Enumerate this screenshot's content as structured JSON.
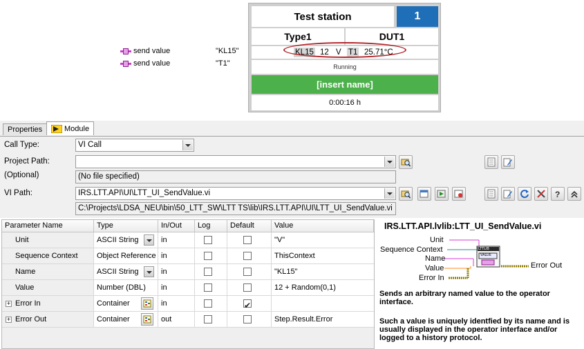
{
  "sequence_steps": [
    {
      "label": "send value",
      "value": "\"KL15\""
    },
    {
      "label": "send value",
      "value": "\"T1\""
    }
  ],
  "station": {
    "title": "Test station",
    "number": "1",
    "type": "Type1",
    "dut": "DUT1",
    "kl15_label": "KL15",
    "kl15_value": "12",
    "kl15_unit": "V",
    "t1_label": "T1",
    "t1_value": "25.71°C",
    "status": "Running",
    "name_placeholder": "[insert name]",
    "elapsed": "0:00:16 h",
    "colors": {
      "number_bg": "#1f6fb8",
      "name_bg": "#4cb04b",
      "highlight_oval": "#b2262a"
    }
  },
  "tabs": [
    {
      "label": "Properties",
      "active": false
    },
    {
      "label": "Module",
      "active": true
    }
  ],
  "form": {
    "call_type_label": "Call Type:",
    "call_type_value": "VI Call",
    "project_path_label": "Project Path:",
    "project_path_value": "",
    "optional_label": "(Optional)",
    "no_file": "(No file specified)",
    "vi_path_label": "VI Path:",
    "vi_path_value": "IRS.LTT.API\\UI\\LTT_UI_SendValue.vi",
    "vi_full_path": "C:\\Projects\\LDSA_NEU\\bin\\50_LTT_SW\\LTT TS\\lib\\IRS.LTT.API\\UI\\LTT_UI_SendValue.vi"
  },
  "table": {
    "headers": [
      "Parameter Name",
      "Type",
      "In/Out",
      "Log",
      "Default",
      "Value"
    ],
    "rows": [
      {
        "name": "Unit",
        "type": "ASCII String",
        "io": "in",
        "log": false,
        "default": false,
        "value": "\"V\"",
        "control": "dropdown",
        "expandable": false
      },
      {
        "name": "Sequence Context",
        "type": "Object Reference",
        "io": "in",
        "log": false,
        "default": false,
        "value": "ThisContext",
        "control": "none",
        "expandable": false
      },
      {
        "name": "Name",
        "type": "ASCII String",
        "io": "in",
        "log": false,
        "default": false,
        "value": "\"KL15\"",
        "control": "dropdown",
        "expandable": false
      },
      {
        "name": "Value",
        "type": "Number (DBL)",
        "io": "in",
        "log": false,
        "default": false,
        "value": "12 + Random(0,1)",
        "control": "none",
        "expandable": false
      },
      {
        "name": "Error In",
        "type": "Container",
        "io": "in",
        "log": false,
        "default": true,
        "value": "",
        "control": "cluster",
        "expandable": true
      },
      {
        "name": "Error Out",
        "type": "Container",
        "io": "out",
        "log": false,
        "default": false,
        "value": "Step.Result.Error",
        "control": "cluster",
        "expandable": true
      }
    ]
  },
  "help": {
    "title": "IRS.LTT.API.lvlib:LTT_UI_SendValue.vi",
    "inputs": [
      "Unit",
      "Sequence Context",
      "Name",
      "Value",
      "Error In"
    ],
    "output": "Error Out",
    "icon_top": "LTTLIB",
    "icon_label": "VALUE",
    "paragraph1": "Sends an arbitrary named value to the operator interface.",
    "paragraph2": "Such a value is uniquely identfied by its name and is usually displayed in the operator interface and/or logged to a history protocol."
  }
}
